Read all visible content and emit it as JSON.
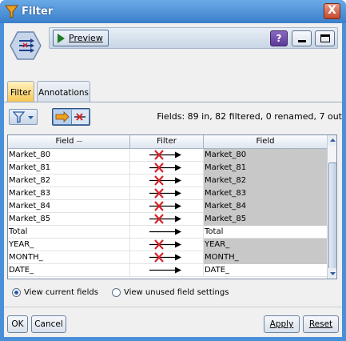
{
  "window": {
    "title": "Filter",
    "close_label": "X"
  },
  "toolbar": {
    "preview_label": "Preview",
    "help_label": "?"
  },
  "tabs": [
    {
      "label": "Filter"
    },
    {
      "label": "Annotations"
    }
  ],
  "summary": "Fields: 89 in, 82 filtered, 0 renamed, 7 out",
  "table": {
    "headers": [
      "Field",
      "Filter",
      "Field"
    ],
    "rows": [
      {
        "input": "Market_80",
        "filter": "filtered",
        "output": "Market_80"
      },
      {
        "input": "Market_81",
        "filter": "filtered",
        "output": "Market_81"
      },
      {
        "input": "Market_82",
        "filter": "filtered",
        "output": "Market_82"
      },
      {
        "input": "Market_83",
        "filter": "filtered",
        "output": "Market_83"
      },
      {
        "input": "Market_84",
        "filter": "filtered",
        "output": "Market_84"
      },
      {
        "input": "Market_85",
        "filter": "filtered",
        "output": "Market_85"
      },
      {
        "input": "Total",
        "filter": "pass",
        "output": "Total"
      },
      {
        "input": "YEAR_",
        "filter": "filtered",
        "output": "YEAR_"
      },
      {
        "input": "MONTH_",
        "filter": "filtered",
        "output": "MONTH_"
      },
      {
        "input": "DATE_",
        "filter": "pass",
        "output": "DATE_"
      }
    ]
  },
  "radios": {
    "current": "View current fields",
    "unused": "View unused field settings"
  },
  "buttons": {
    "ok": "OK",
    "cancel": "Cancel",
    "apply": "Apply",
    "reset": "Reset"
  },
  "colors": {
    "title_bar": "#3b7fcb",
    "filtered_cell": "#c8c8c8",
    "cross": "#d8232a",
    "active_tab": "#f8c64e"
  }
}
